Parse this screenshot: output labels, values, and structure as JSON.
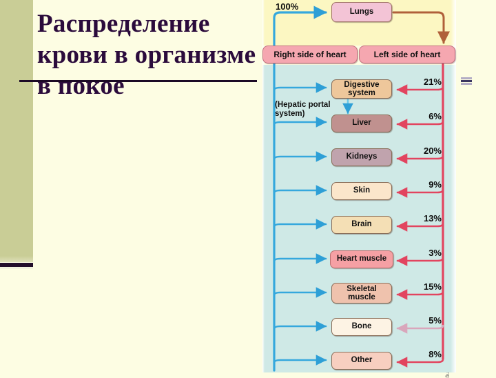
{
  "slide": {
    "title": "Распределение крови в организме в покое",
    "copyright": "© Brooks/Cole - Thomson Learning"
  },
  "diagram": {
    "input_label": "100%",
    "lungs": "Lungs",
    "right_heart": "Right side of heart",
    "left_heart": "Left side of heart",
    "hepatic_note": "(Hepatic portal system)",
    "organs": [
      {
        "name": "Digestive system",
        "percent": "21%"
      },
      {
        "name": "Liver",
        "percent": "6%"
      },
      {
        "name": "Kidneys",
        "percent": "20%"
      },
      {
        "name": "Skin",
        "percent": "9%"
      },
      {
        "name": "Brain",
        "percent": "13%"
      },
      {
        "name": "Heart muscle",
        "percent": "3%"
      },
      {
        "name": "Skeletal muscle",
        "percent": "15%"
      },
      {
        "name": "Bone",
        "percent": "5%"
      },
      {
        "name": "Other",
        "percent": "8%"
      }
    ]
  },
  "colors": {
    "slide_background": "#fdfde3",
    "side_strip": "#c9cd96",
    "title_text": "#2b0b3c",
    "diagram_top_background": "#fcf7c2",
    "diagram_bottom_background": "#cfe9e6",
    "vein_blue": "#35a8dd",
    "artery_red": "#e2445f",
    "lungs_fill": "#f3c4d6",
    "heart_fill": "#f5a7b0",
    "digestive_fill": "#eec79b",
    "liver_fill": "#c0918f",
    "kidneys_fill": "#c0a3ad",
    "skin_fill": "#fbe6cb",
    "brain_fill": "#f4dfb5",
    "heart_muscle_fill": "#f5a0a4",
    "skeletal_fill": "#efc2ad",
    "bone_fill": "#fdf3e4",
    "other_fill": "#f7cfc0"
  }
}
